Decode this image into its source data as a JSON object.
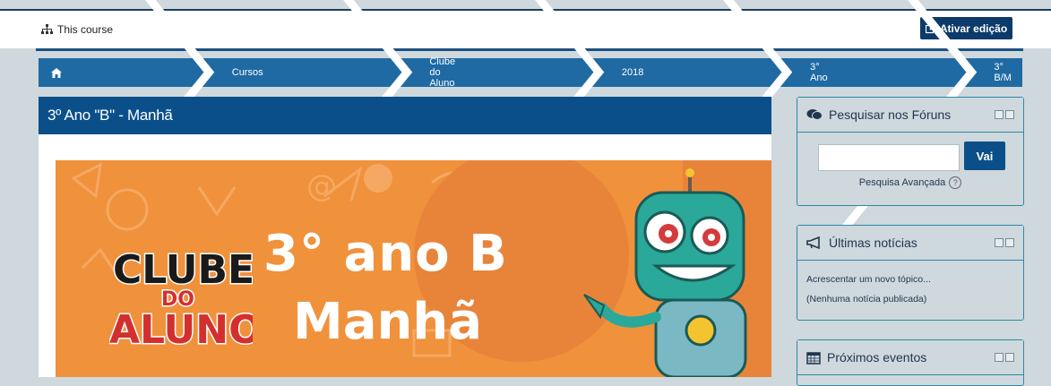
{
  "topbar": {
    "course_label": "This course",
    "edit_button": "Ativar edição"
  },
  "breadcrumb": {
    "items": [
      "Cursos",
      "Clube do Aluno",
      "2018",
      "3° Ano",
      "3° B/M"
    ]
  },
  "main": {
    "title": "3º Ano \"B\" - Manhã",
    "banner": {
      "logo_line1": "CLUBE",
      "logo_line2": "DO",
      "logo_line3": "ALUNO",
      "line1": "3° ano B",
      "line2": "Manhã"
    }
  },
  "blocks": {
    "forum_search": {
      "title": "Pesquisar nos Fóruns",
      "button": "Vai",
      "advanced": "Pesquisa Avançada",
      "input_value": ""
    },
    "news": {
      "title": "Últimas notícias",
      "add_topic": "Acrescentar um novo tópico...",
      "empty": "(Nenhuma notícia publicada)"
    },
    "events": {
      "title": "Próximos eventos"
    }
  },
  "colors": {
    "primary_dark": "#0b4f8a",
    "breadcrumb_bg": "#1f6aa3",
    "banner_orange": "#f0913c",
    "page_bg": "#cfd8dc"
  }
}
